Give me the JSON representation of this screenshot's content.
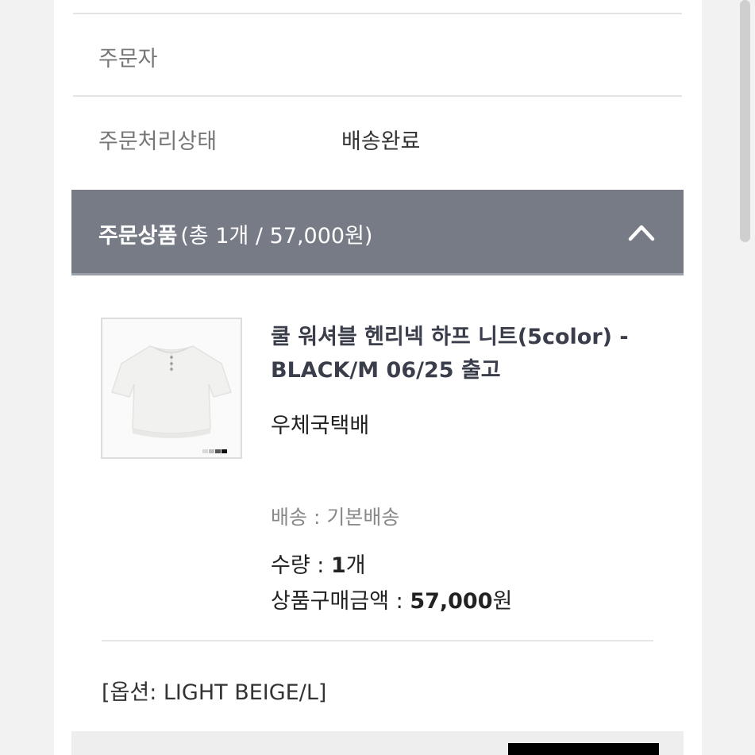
{
  "order_info": {
    "orderer_label": "주문자",
    "orderer_value": "",
    "status_label": "주문처리상태",
    "status_value": "배송완료"
  },
  "order_items_section": {
    "title": "주문상품",
    "summary": "(총 1개 / 57,000원)",
    "toggle_icon": "chevron-up-icon"
  },
  "product": {
    "name": "쿨 워셔블 헨리넥 하프 니트(5color) - BLACK/M 06/25 출고",
    "shipping_company": "우체국택배",
    "delivery_label": "배송 : 기본배송",
    "quantity_label": "수량 : ",
    "quantity_value": "1",
    "quantity_unit": "개",
    "amount_label": "상품구매금액 : ",
    "amount_value": "57,000",
    "amount_unit": "원",
    "option": "[옵션: LIGHT BEIGE/L]",
    "color_swatches": [
      "#d9d9d9",
      "#bdbdbd",
      "#555555",
      "#111111"
    ]
  },
  "colors": {
    "section_header_bg": "#777b85",
    "product_name": "#3a3d4a"
  }
}
